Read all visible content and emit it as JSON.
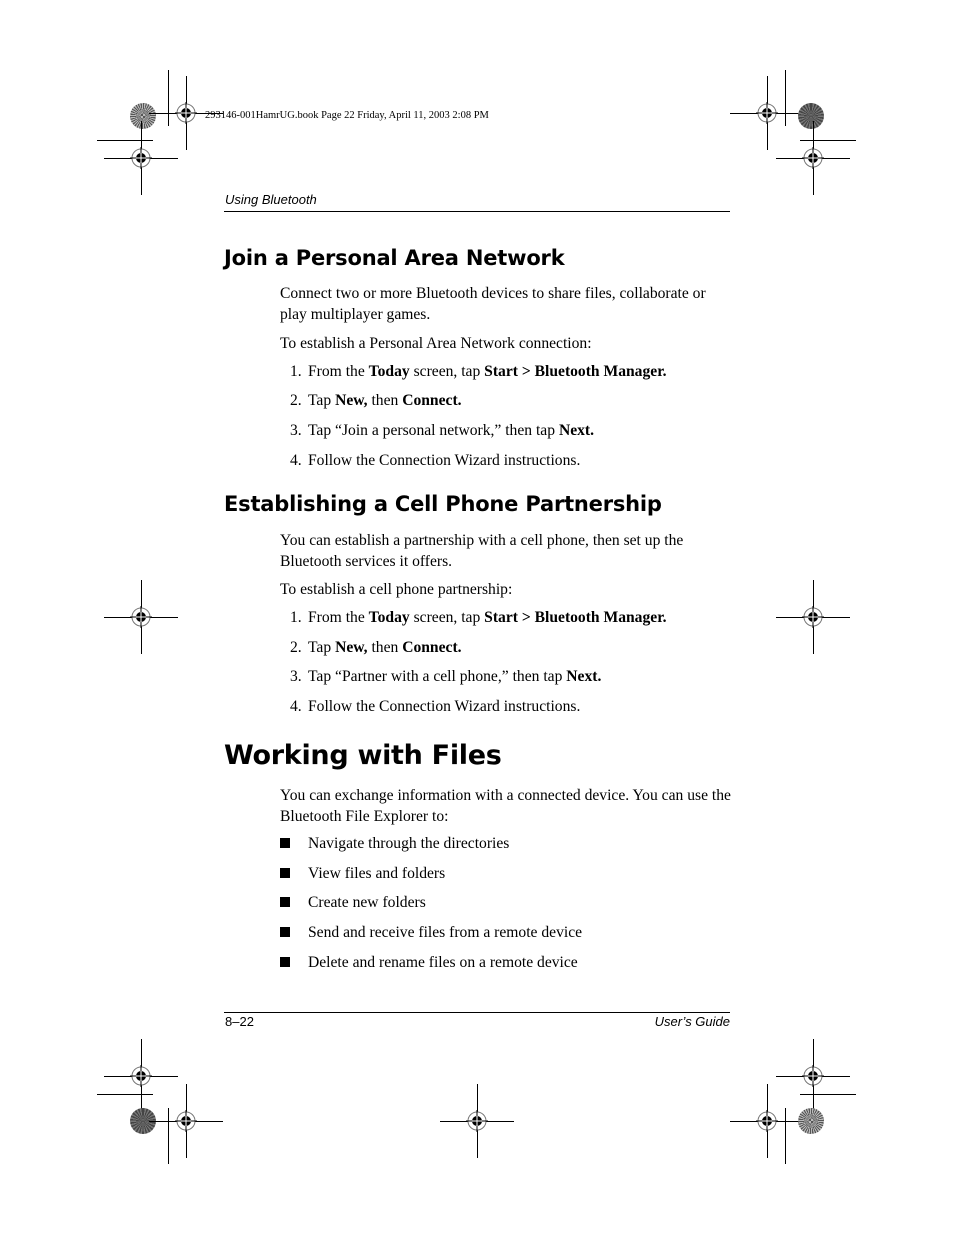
{
  "slug": "293146-001HamrUG.book  Page 22  Friday, April 11, 2003  2:08 PM",
  "running_head": "Using Bluetooth",
  "sections": {
    "pan": {
      "heading": "Join a Personal Area Network",
      "intro": "Connect two or more Bluetooth devices to share files, collaborate or play multiplayer games.",
      "lead": "To establish a Personal Area Network connection:",
      "steps": [
        {
          "num": "1.",
          "parts": [
            "From the ",
            "Today",
            " screen, tap ",
            "Start > Bluetooth Manager."
          ]
        },
        {
          "num": "2.",
          "parts": [
            "Tap ",
            "New,",
            " then ",
            "Connect."
          ]
        },
        {
          "num": "3.",
          "parts": [
            "Tap “Join a personal network,” then tap ",
            "Next."
          ]
        },
        {
          "num": "4.",
          "parts": [
            "Follow the Connection Wizard instructions."
          ]
        }
      ]
    },
    "cell": {
      "heading": "Establishing a Cell Phone Partnership",
      "intro": "You can establish a partnership with a cell phone, then set up the Bluetooth services it offers.",
      "lead": "To establish a cell phone partnership:",
      "steps": [
        {
          "num": "1.",
          "parts": [
            "From the ",
            "Today",
            " screen, tap ",
            "Start > Bluetooth Manager."
          ]
        },
        {
          "num": "2.",
          "parts": [
            "Tap ",
            "New,",
            " then ",
            "Connect."
          ]
        },
        {
          "num": "3.",
          "parts": [
            "Tap “Partner with a cell phone,” then tap ",
            "Next."
          ]
        },
        {
          "num": "4.",
          "parts": [
            "Follow the Connection Wizard instructions."
          ]
        }
      ]
    },
    "files": {
      "heading": "Working with Files",
      "intro": "You can exchange information with a connected device. You can use the Bluetooth File Explorer to:",
      "bullets": [
        "Navigate through the directories",
        "View files and folders",
        "Create new folders",
        "Send and receive files from a remote device",
        "Delete and rename files on a remote device"
      ]
    }
  },
  "footer": {
    "page_number": "8–22",
    "guide": "User’s Guide"
  },
  "icons": {
    "registration_mark": "registration-crosshair",
    "color_target": "color-target-circle"
  }
}
